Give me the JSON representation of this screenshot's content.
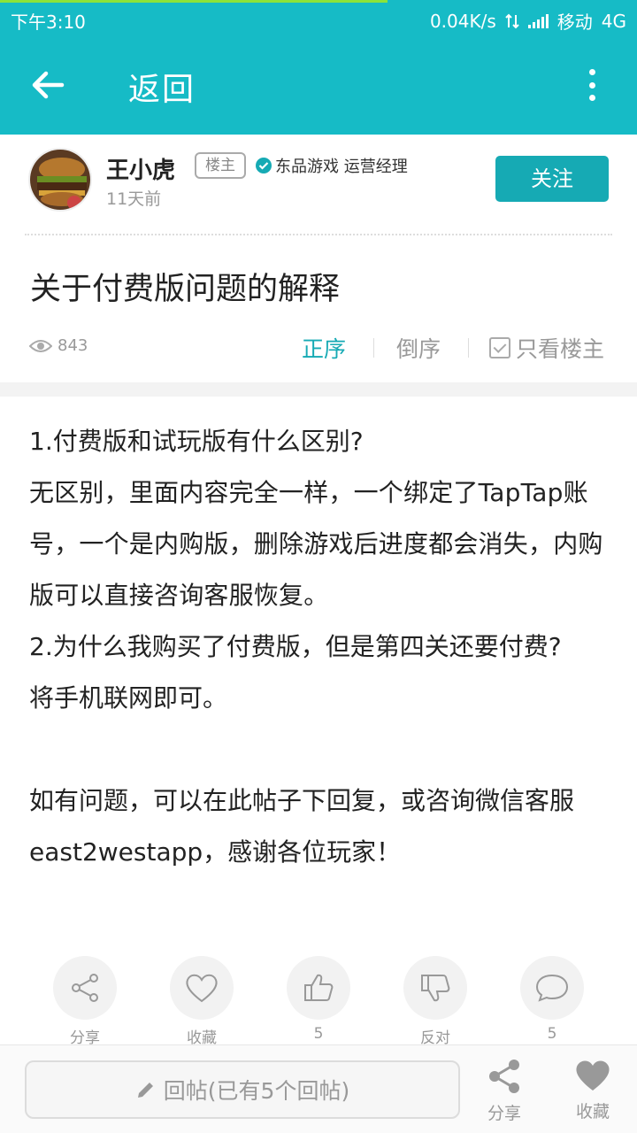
{
  "status_bar": {
    "time": "下午3:10",
    "speed": "0.04K/s",
    "carrier": "移动",
    "network": "4G"
  },
  "app_bar": {
    "back_label": "返回"
  },
  "author": {
    "name": "王小虎",
    "badge": "楼主",
    "verified_text": "东品游戏 运营经理",
    "time_ago": "11天前",
    "follow_label": "关注"
  },
  "post": {
    "title": "关于付费版问题的解释",
    "views": "843",
    "sort_asc": "正序",
    "sort_desc": "倒序",
    "owner_only": "只看楼主",
    "paragraphs": [
      "1.付费版和试玩版有什么区别?",
      "无区别，里面内容完全一样，一个绑定了TapTap账号，一个是内购版，删除游戏后进度都会消失，内购版可以直接咨询客服恢复。",
      "2.为什么我购买了付费版，但是第四关还要付费?",
      "将手机联网即可。",
      "",
      "如有问题，可以在此帖子下回复，或咨询微信客服east2westapp，感谢各位玩家！"
    ]
  },
  "actions": {
    "share": "分享",
    "favorite": "收藏",
    "like_count": "5",
    "oppose": "反对",
    "comment_count": "5"
  },
  "bottom_bar": {
    "reply_placeholder": "回帖(已有5个回帖)",
    "share": "分享",
    "favorite": "收藏"
  },
  "colors": {
    "primary": "#16bbc6",
    "accent": "#16aab4",
    "progress": "#8be33a"
  }
}
